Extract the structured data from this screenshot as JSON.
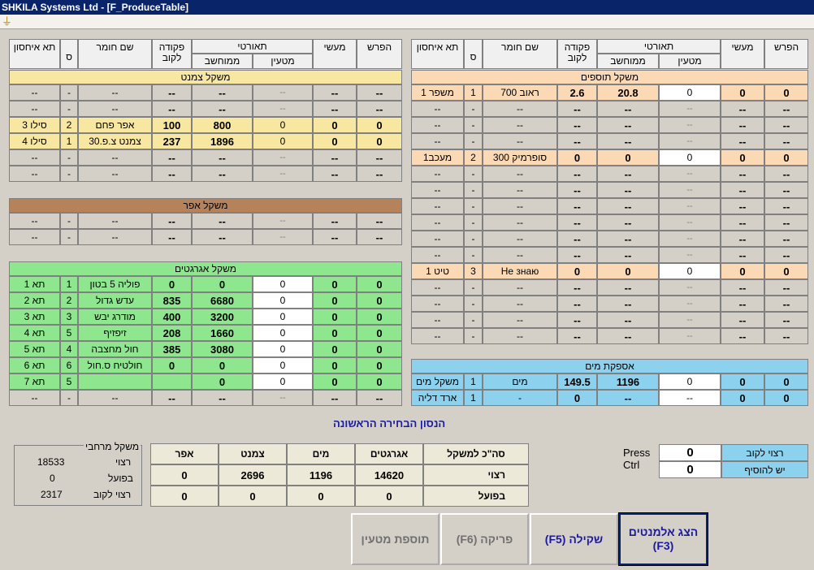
{
  "window": {
    "title": "SHKILA Systems Ltd - [F_ProduceTable]"
  },
  "menubar": {
    "icon": "filter-icon"
  },
  "headers": {
    "hafresh": "הפרש",
    "maasi": "מעשי",
    "taorti": "תאורטי",
    "muten": "מטעין",
    "mehushav": "ממוחשב",
    "pkuda": "פקודה לקוב",
    "shem": "שם חומר",
    "s": "ס",
    "ta": "תא איחסון",
    "ta_right": "תא איחסון"
  },
  "left": {
    "cement": {
      "title": "משקל צמנט",
      "rows": [
        [
          "--",
          "--",
          "--",
          "--",
          "--",
          "-",
          "--"
        ],
        [
          "--",
          "--",
          "--",
          "--",
          "--",
          "-",
          "--"
        ],
        [
          "0",
          "0",
          "0",
          "800",
          "100",
          "אפר פחם",
          "2",
          "סילו 3"
        ],
        [
          "0",
          "0",
          "0",
          "1896",
          "237",
          "צמנט צ.פ.30",
          "1",
          "סילו 4"
        ],
        [
          "--",
          "--",
          "--",
          "--",
          "--",
          "-",
          "--"
        ],
        [
          "--",
          "--",
          "--",
          "--",
          "--",
          "-",
          "--"
        ]
      ]
    },
    "ash": {
      "title": "משקל אפר"
    },
    "agg": {
      "title": "משקל אגרגטים",
      "rows": [
        [
          "0",
          "0",
          "0",
          "0",
          "0",
          "פוליה 5 בטון",
          "1",
          "תא 1"
        ],
        [
          "0",
          "0",
          "0",
          "6680",
          "835",
          "עדש גדול",
          "2",
          "תא 2"
        ],
        [
          "0",
          "0",
          "0",
          "3200",
          "400",
          "מודרג  יבש",
          "3",
          "תא 3"
        ],
        [
          "0",
          "0",
          "0",
          "1660",
          "208",
          "זיפזיף",
          "5",
          "תא 4"
        ],
        [
          "0",
          "0",
          "0",
          "3080",
          "385",
          "חול מחצבה",
          "4",
          "תא 5"
        ],
        [
          "0",
          "0",
          "0",
          "0",
          "0",
          "חולטיח ס.חול",
          "6",
          "תא 6"
        ],
        [
          "0",
          "0",
          "0",
          "0",
          "",
          "",
          "5",
          "תא 7"
        ]
      ]
    }
  },
  "right": {
    "additives": {
      "title": "משקל תוספים",
      "rows": [
        [
          "0",
          "0",
          "0",
          "20.8",
          "2.6",
          "ראוב 700",
          "1",
          "משפר 1"
        ],
        [
          "0",
          "0",
          "0",
          "0",
          "0",
          "סופרמיק 300",
          "2",
          "מעכב1"
        ],
        [
          "0",
          "0",
          "0",
          "0",
          "0",
          "Не знаю",
          "3",
          "טיט 1"
        ]
      ]
    },
    "water": {
      "title": "אספקת מים",
      "rows": [
        [
          "0",
          "0",
          "0",
          "1196",
          "149.5",
          "מים",
          "1",
          "משקל מים"
        ],
        [
          "0",
          "0",
          "--",
          "--",
          "0",
          "-",
          "1",
          "ארד דליה"
        ]
      ]
    }
  },
  "dashes": {
    "d2": "--",
    "d1": "-"
  },
  "message": "הנסון הבחירה הראשונה",
  "summary": {
    "header": "סה\"כ למשקל",
    "cols": [
      "אגרגטים",
      "מים",
      "צמנט",
      "אפר"
    ],
    "rows": [
      {
        "label": "רצוי",
        "vals": [
          "14620",
          "1196",
          "2696",
          "0"
        ]
      },
      {
        "label": "בפועל",
        "vals": [
          "0",
          "0",
          "0",
          "0"
        ]
      }
    ]
  },
  "mixer": {
    "title": "משקל מרחבי",
    "rows": [
      {
        "label": "רצוי",
        "val": "18533"
      },
      {
        "label": "בפועל",
        "val": "0"
      },
      {
        "label": "רצוי לקוב",
        "val": "2317"
      }
    ]
  },
  "press": {
    "line1": "Press",
    "line2": "Ctrl",
    "desired_val": "0",
    "desired_label": "רצוי לקוב",
    "add_val": "0",
    "add_label": "יש להוסיף"
  },
  "buttons": {
    "show": "הצג אלמנטים (F3)",
    "weigh": "(F5) שקילה",
    "unload": "(F6) פריקה",
    "add": "תוספת מטעין"
  },
  "colors": {
    "cement": "#f7e7a1",
    "ash": "#b5825a",
    "agg": "#8ee68e",
    "additive": "#fbd9b4",
    "water": "#8cd2ef"
  }
}
